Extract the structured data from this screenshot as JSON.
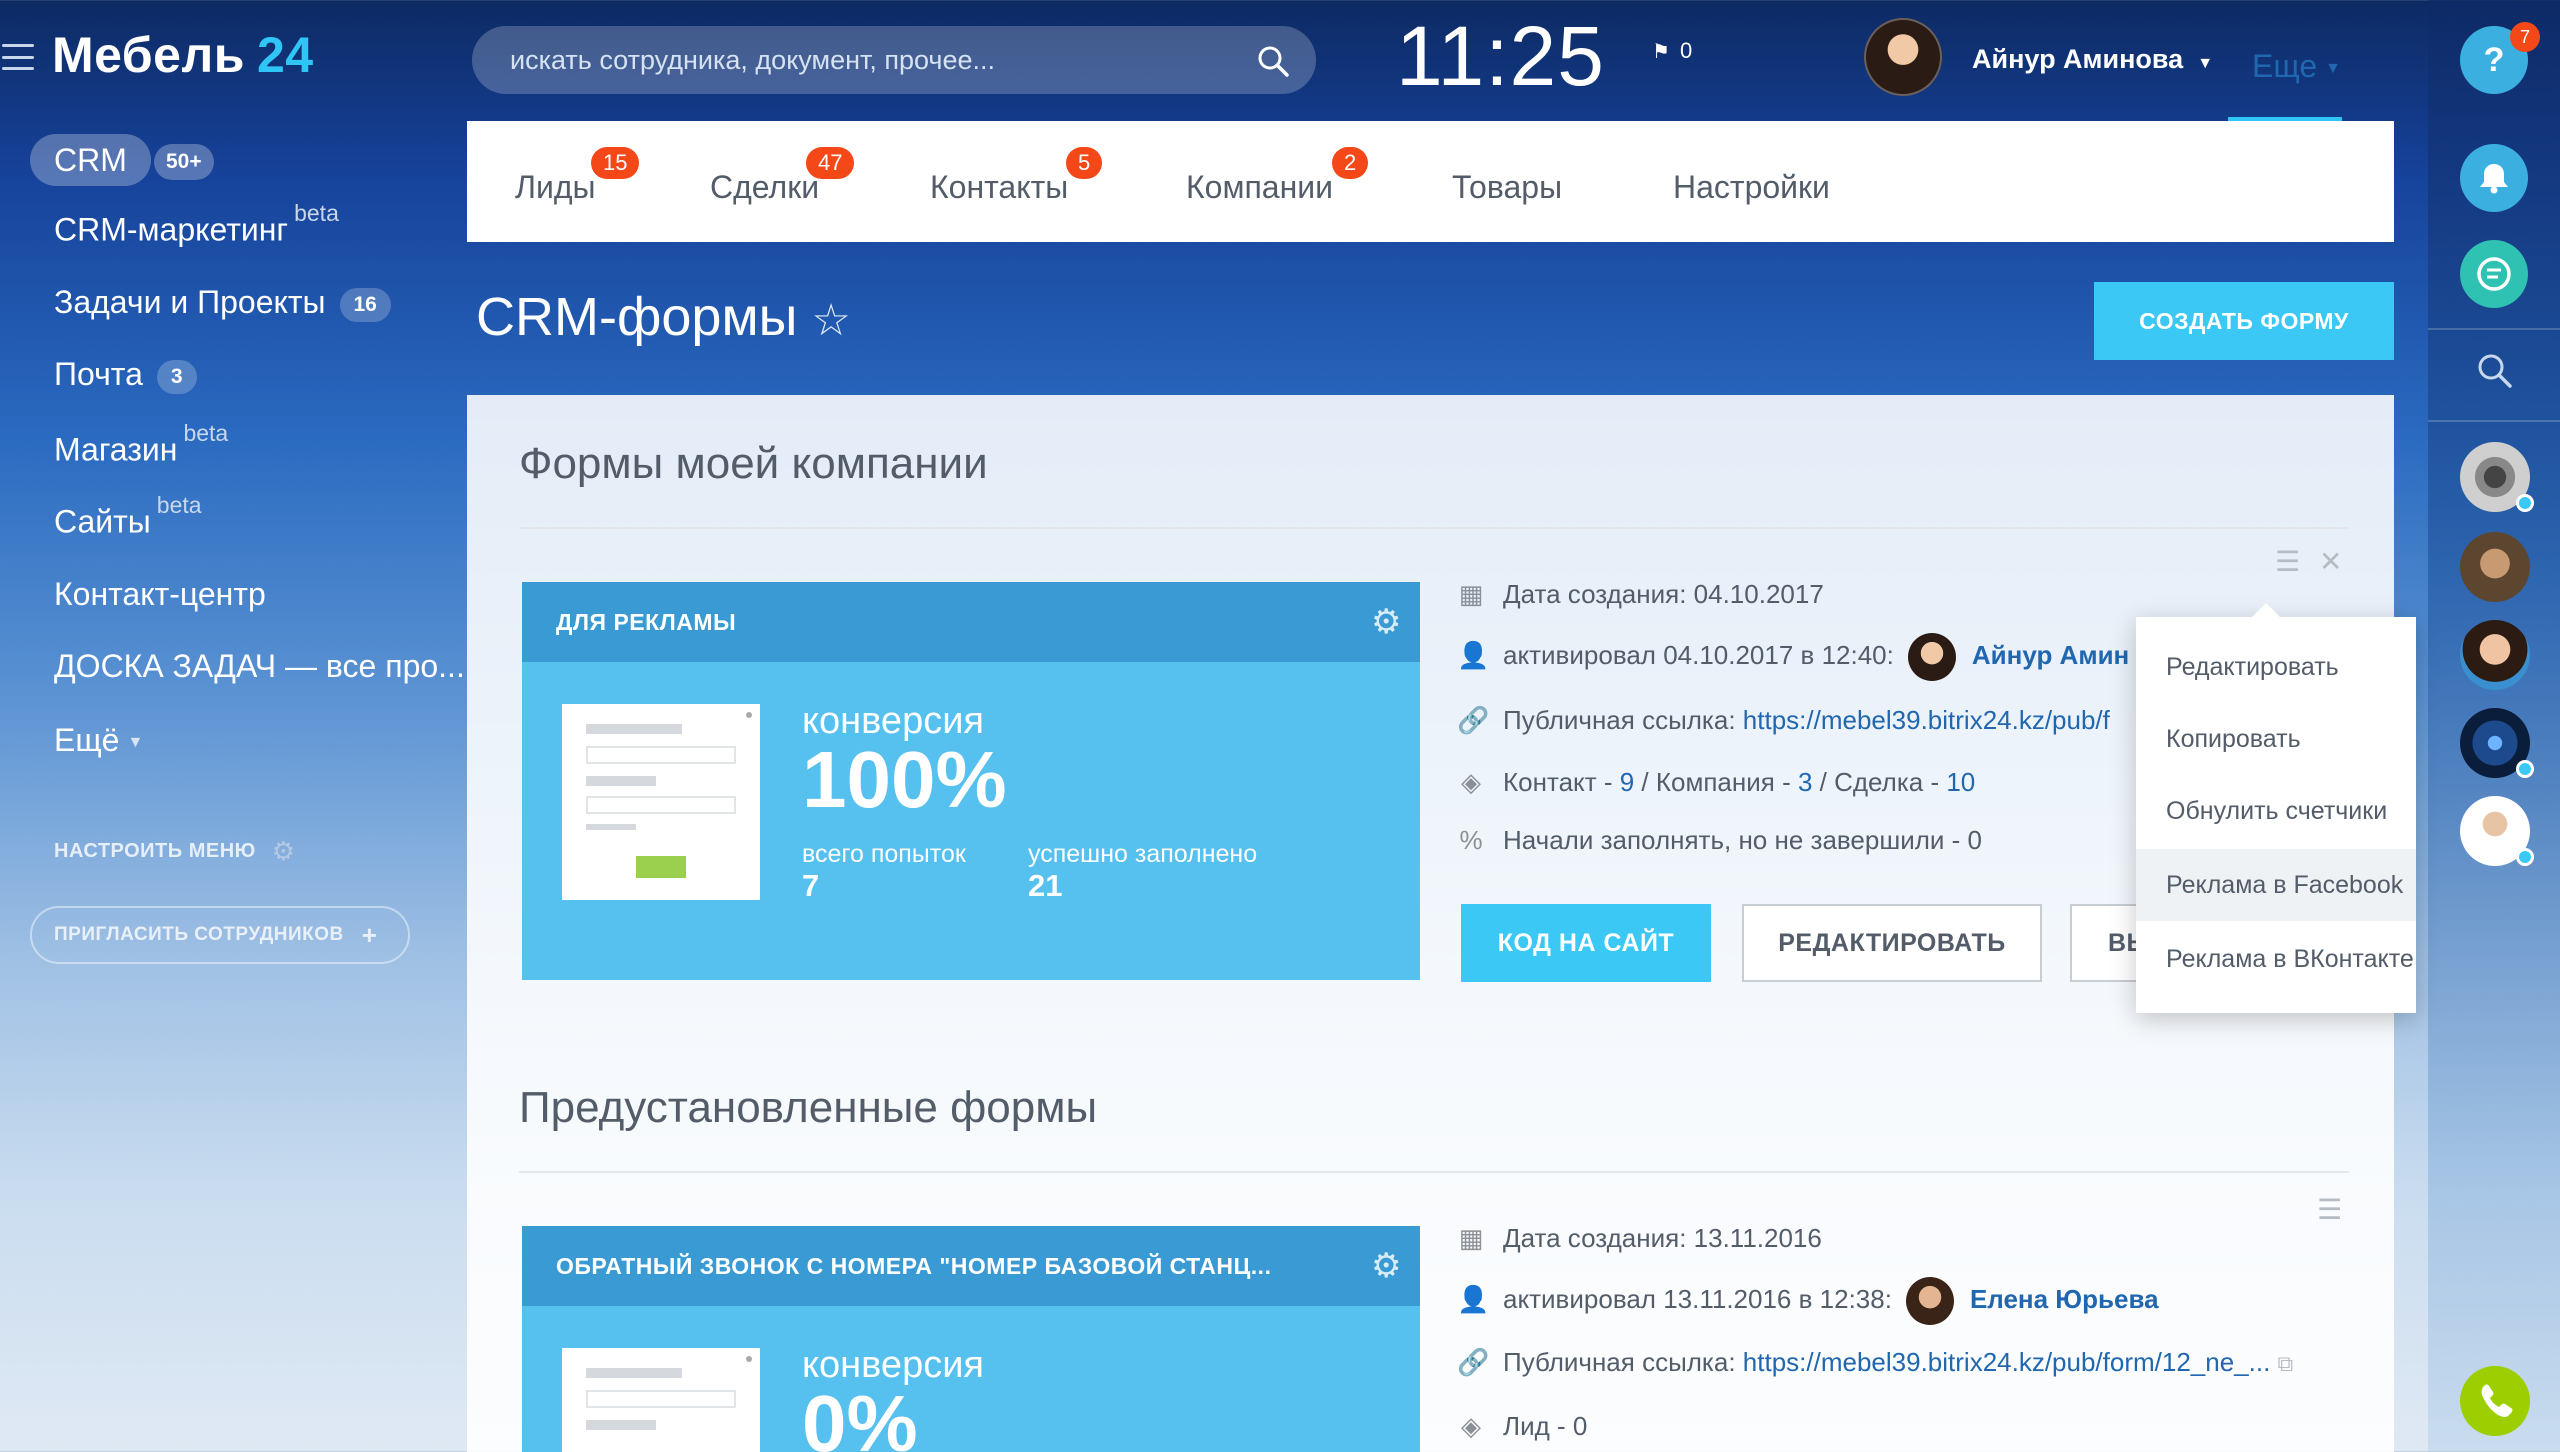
{
  "app": {
    "logo_main": "Мебель",
    "logo_num": "24"
  },
  "sidebar": {
    "crm_label": "CRM",
    "crm_count": "50+",
    "items": [
      {
        "label": "CRM-маркетинг",
        "sup": "beta"
      },
      {
        "label": "Задачи и Проекты",
        "badge": "16"
      },
      {
        "label": "Почта",
        "badge": "3"
      },
      {
        "label": "Магазин",
        "sup": "beta"
      },
      {
        "label": "Сайты",
        "sup": "beta"
      },
      {
        "label": "Контакт-центр"
      },
      {
        "label": "ДОСКА ЗАДАЧ — все про..."
      }
    ],
    "more_label": "Ещё",
    "setup_menu": "НАСТРОИТЬ МЕНЮ",
    "invite": "ПРИГЛАСИТЬ СОТРУДНИКОВ"
  },
  "header": {
    "search_placeholder": "искать сотрудника, документ, прочее...",
    "clock": "11:25",
    "flag_count": "0",
    "user_name": "Айнур Аминова"
  },
  "tabs": [
    {
      "label": "Лиды",
      "badge": "15"
    },
    {
      "label": "Сделки",
      "badge": "47"
    },
    {
      "label": "Контакты",
      "badge": "5"
    },
    {
      "label": "Компании",
      "badge": "2"
    },
    {
      "label": "Товары"
    },
    {
      "label": "Настройки"
    }
  ],
  "tab_more": "Еще",
  "page": {
    "title": "CRM-формы",
    "create_button": "СОЗДАТЬ ФОРМУ"
  },
  "section1": {
    "title": "Формы моей компании",
    "card": {
      "name": "ДЛЯ РЕКЛАМЫ",
      "conv_label": "конверсия",
      "conv_value": "100%",
      "attempts_label": "всего попыток",
      "attempts_value": "7",
      "filled_label": "успешно заполнено",
      "filled_value": "21"
    },
    "info": {
      "created_label": "Дата создания:",
      "created_value": "04.10.2017",
      "activated_label": "активировал 04.10.2017 в 12:40:",
      "activated_user": "Айнур Амин",
      "link_label": "Публичная ссылка:",
      "link_value": "https://mebel39.bitrix24.kz/pub/f",
      "crm_contact": "Контакт - ",
      "crm_contact_n": "9",
      "crm_company": " / Компания - ",
      "crm_company_n": "3",
      "crm_deal": " / Сделка - ",
      "crm_deal_n": "10",
      "unfinished": "Начали заполнять, но не завершили - 0"
    },
    "buttons": {
      "code": "КОД НА САЙТ",
      "edit": "РЕДАКТИРОВАТЬ",
      "third": "ВЫ"
    }
  },
  "dropdown": [
    "Редактировать",
    "Копировать",
    "Обнулить счетчики",
    "Реклама в Facebook",
    "Реклама в ВКонтакте"
  ],
  "section2": {
    "title": "Предустановленные формы",
    "card": {
      "name": "ОБРАТНЫЙ ЗВОНОК С НОМЕРА \"НОМЕР БАЗОВОЙ СТАНЦ...",
      "conv_label": "конверсия",
      "conv_value": "0%"
    },
    "info": {
      "created_label": "Дата создания:",
      "created_value": "13.11.2016",
      "activated_label": "активировал 13.11.2016 в 12:38:",
      "activated_user": "Елена Юрьева",
      "link_label": "Публичная ссылка:",
      "link_value": "https://mebel39.bitrix24.kz/pub/form/12_ne_...",
      "lead": "Лид - 0"
    }
  },
  "rightbar": {
    "help_badge": "7",
    "help_icon": "?"
  },
  "colors": {
    "accent": "#3bc8f5",
    "badge": "#f54819",
    "link": "#2067b0",
    "card": "#56c0ee",
    "card_head": "#3a9bd4"
  }
}
